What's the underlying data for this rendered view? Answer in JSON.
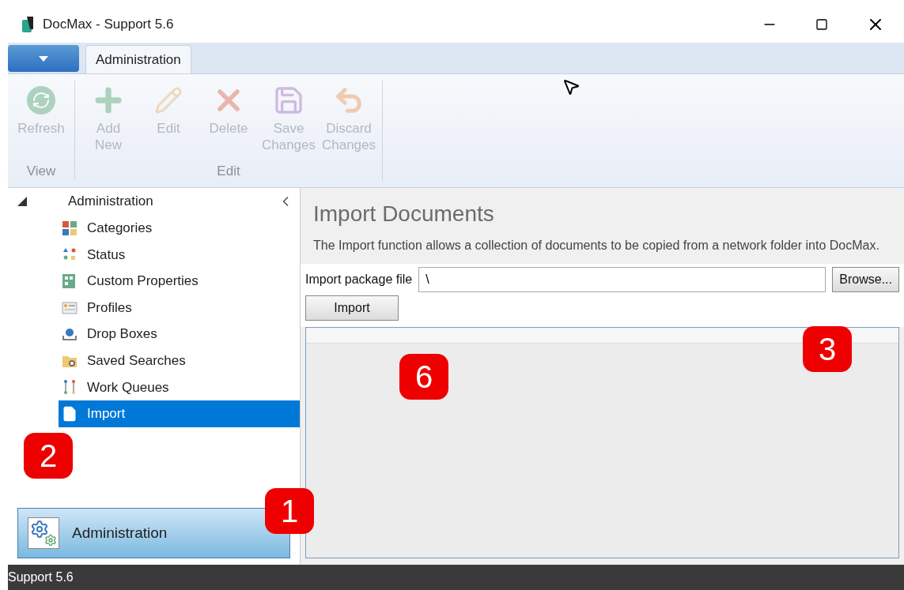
{
  "window": {
    "title": "DocMax - Support 5.6"
  },
  "ribbon": {
    "tabs": [
      {
        "label": "Administration",
        "selected": true
      }
    ],
    "groups": [
      {
        "label": "View",
        "buttons": [
          {
            "label": "Refresh",
            "disabled": true
          }
        ]
      },
      {
        "label": "Edit",
        "buttons": [
          {
            "label": "Add New",
            "disabled": true
          },
          {
            "label": "Edit",
            "disabled": true
          },
          {
            "label": "Delete",
            "disabled": true
          },
          {
            "label": "Save Changes",
            "disabled": true
          },
          {
            "label": "Discard Changes",
            "disabled": true
          }
        ]
      }
    ]
  },
  "tree": {
    "label": "Administration",
    "expanded": true,
    "children": [
      {
        "label": "Categories",
        "selected": false
      },
      {
        "label": "Status",
        "selected": false
      },
      {
        "label": "Custom Properties",
        "selected": false
      },
      {
        "label": "Profiles",
        "selected": false
      },
      {
        "label": "Drop Boxes",
        "selected": false
      },
      {
        "label": "Saved Searches",
        "selected": false
      },
      {
        "label": "Work Queues",
        "selected": false
      },
      {
        "label": "Import",
        "selected": true
      }
    ]
  },
  "nav_button": {
    "label": "Administration"
  },
  "content": {
    "title": "Import Documents",
    "description": "The Import function allows a collection of documents to be copied from a network folder into DocMax.",
    "field_label": "Import package file",
    "field_value": "\\",
    "browse_button": "Browse...",
    "import_button": "Import"
  },
  "callouts": [
    {
      "label": "1"
    },
    {
      "label": "2"
    },
    {
      "label": "3"
    },
    {
      "label": "6"
    }
  ],
  "status_bar": {
    "text": "Support 5.6"
  }
}
